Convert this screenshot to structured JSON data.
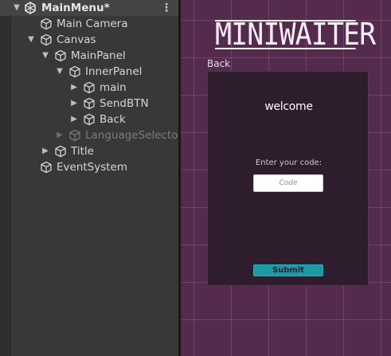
{
  "hierarchy": {
    "scene": {
      "label": "MainMenu*",
      "menu": "⋮"
    },
    "items": [
      {
        "label": "Main Camera"
      },
      {
        "label": "Canvas"
      },
      {
        "label": "MainPanel"
      },
      {
        "label": "InnerPanel"
      },
      {
        "label": "main"
      },
      {
        "label": "SendBTN"
      },
      {
        "label": "Back"
      },
      {
        "label": "LanguageSelector"
      },
      {
        "label": "Title"
      },
      {
        "label": "EventSystem"
      }
    ]
  },
  "scene": {
    "logo": "MINIWAITER",
    "back_label": "Back",
    "welcome": "welcome",
    "code_label": "Enter your code:",
    "code_placeholder": "Code",
    "code_value": "",
    "submit_label": "Submit"
  },
  "colors": {
    "scene_bg": "#542a4d",
    "panel_bg": "#2e1d2c",
    "submit_bg": "#1a9aa3",
    "hierarchy_bg": "#383838"
  }
}
